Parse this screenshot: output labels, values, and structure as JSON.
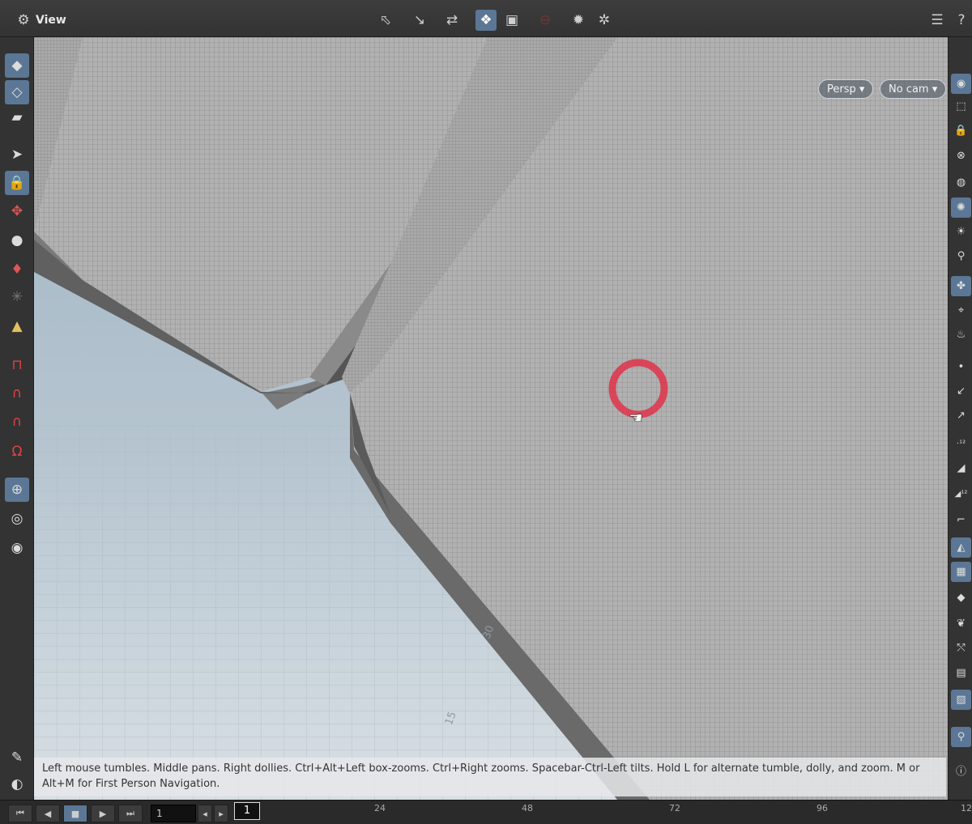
{
  "topbar": {
    "title": "View",
    "icons": [
      "view-pane-icon",
      "select-transform-icon",
      "handle-icon",
      "pose-icon",
      "display-options-icon",
      "wireframe-toggle-icon",
      "ghost-icon",
      "lights-icon",
      "settings-gear-icon",
      "layout-icon",
      "help-icon"
    ]
  },
  "viewport": {
    "persp_label": "Persp ▾",
    "cam_label": "No cam ▾",
    "grid_label_a": "30",
    "grid_label_b": "15",
    "status_message": "Left mouse tumbles. Middle pans. Right dollies. Ctrl+Alt+Left box-zooms. Ctrl+Right zooms. Spacebar-Ctrl-Left tilts. Hold L for alternate tumble, dolly, and zoom.    M or Alt+M for First Person Navigation."
  },
  "timeline": {
    "frame_input": "1",
    "current_frame": "1",
    "ticks": [
      "24",
      "48",
      "72",
      "96",
      "12"
    ]
  },
  "colors": {
    "accent": "#5b7795",
    "cursor_ring": "#e0344a",
    "sky": "#9fb3c3",
    "mesh": "#b0b0b0"
  }
}
